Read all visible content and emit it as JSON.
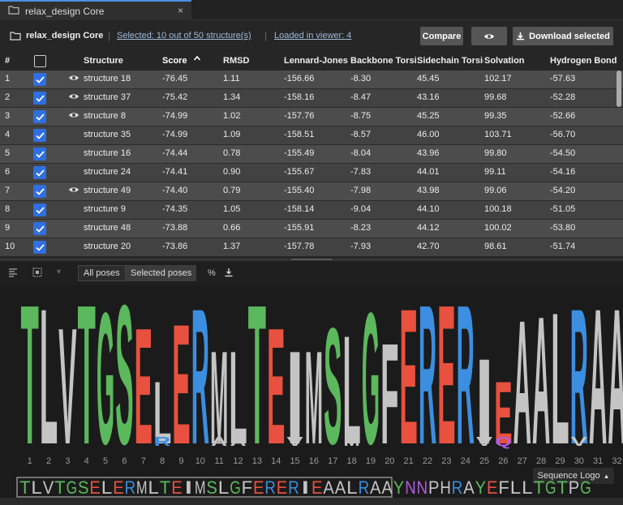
{
  "tab": {
    "title": "relax_design Core",
    "close": "×"
  },
  "toolbar": {
    "project": "relax_design Core",
    "selected": "Selected: 10 out of 50 structure(s)",
    "loaded": "Loaded in viewer: 4",
    "compare": "Compare",
    "download": "Download selected"
  },
  "table": {
    "columns": [
      "#",
      "Structure",
      "Score",
      "RMSD",
      "Lennard-Jones",
      "Backbone Torsic",
      "Sidechain Torsic",
      "Solvation",
      "Hydrogen Bond"
    ],
    "rows": [
      {
        "n": "1",
        "structure": "structure 18",
        "score": "-76.45",
        "rmsd": "1.11",
        "lj": "-156.66",
        "bb": "-8.30",
        "sc": "45.45",
        "solv": "102.17",
        "hb": "-57.63",
        "eye": true
      },
      {
        "n": "2",
        "structure": "structure 37",
        "score": "-75.42",
        "rmsd": "1.34",
        "lj": "-158.16",
        "bb": "-8.47",
        "sc": "43.16",
        "solv": "99.68",
        "hb": "-52.28",
        "eye": true
      },
      {
        "n": "3",
        "structure": "structure 8",
        "score": "-74.99",
        "rmsd": "1.02",
        "lj": "-157.76",
        "bb": "-8.75",
        "sc": "45.25",
        "solv": "99.35",
        "hb": "-52.66",
        "eye": true
      },
      {
        "n": "4",
        "structure": "structure 35",
        "score": "-74.99",
        "rmsd": "1.09",
        "lj": "-158.51",
        "bb": "-8.57",
        "sc": "46.00",
        "solv": "103.71",
        "hb": "-56.70",
        "eye": false
      },
      {
        "n": "5",
        "structure": "structure 16",
        "score": "-74.44",
        "rmsd": "0.78",
        "lj": "-155.49",
        "bb": "-8.04",
        "sc": "43.96",
        "solv": "99.80",
        "hb": "-54.50",
        "eye": false
      },
      {
        "n": "6",
        "structure": "structure 24",
        "score": "-74.41",
        "rmsd": "0.90",
        "lj": "-155.67",
        "bb": "-7.83",
        "sc": "44.01",
        "solv": "99.11",
        "hb": "-54.16",
        "eye": false
      },
      {
        "n": "7",
        "structure": "structure 49",
        "score": "-74.40",
        "rmsd": "0.79",
        "lj": "-155.40",
        "bb": "-7.98",
        "sc": "43.98",
        "solv": "99.06",
        "hb": "-54.20",
        "eye": true
      },
      {
        "n": "8",
        "structure": "structure 9",
        "score": "-74.35",
        "rmsd": "1.05",
        "lj": "-158.14",
        "bb": "-9.04",
        "sc": "44.10",
        "solv": "100.18",
        "hb": "-51.05",
        "eye": false
      },
      {
        "n": "9",
        "structure": "structure 48",
        "score": "-73.88",
        "rmsd": "0.66",
        "lj": "-155.91",
        "bb": "-8.23",
        "sc": "44.12",
        "solv": "100.02",
        "hb": "-53.80",
        "eye": false
      },
      {
        "n": "10",
        "structure": "structure 20",
        "score": "-73.86",
        "rmsd": "1.37",
        "lj": "-157.78",
        "bb": "-7.93",
        "sc": "42.70",
        "solv": "98.61",
        "hb": "-51.74",
        "eye": false
      }
    ]
  },
  "logo_toolbar": {
    "all_poses": "All poses",
    "selected_poses": "Selected poses",
    "percent": "%"
  },
  "logo": {
    "letters": [
      "T",
      "L",
      "V",
      "T",
      "G",
      "S",
      "E",
      "L",
      "E",
      "R",
      "M",
      "L",
      "T",
      "E",
      "I",
      "M",
      "S",
      "L",
      "G",
      "F",
      "E",
      "R",
      "E",
      "R",
      "I",
      "E",
      "A",
      "A",
      "L",
      "R",
      "A",
      "A"
    ],
    "secondary": [
      "",
      "",
      "",
      "",
      "",
      "",
      "",
      "R",
      "",
      "",
      "A",
      "A",
      "",
      "",
      "V",
      "",
      "",
      "M",
      "",
      "",
      "",
      "",
      "",
      "",
      "V",
      "Q",
      "",
      "",
      "",
      "V",
      "",
      ""
    ],
    "positions": [
      "1",
      "2",
      "3",
      "4",
      "5",
      "6",
      "7",
      "8",
      "9",
      "10",
      "11",
      "12",
      "13",
      "14",
      "15",
      "16",
      "17",
      "18",
      "19",
      "20",
      "21",
      "22",
      "23",
      "24",
      "25",
      "26",
      "27",
      "28",
      "29",
      "30",
      "31",
      "32"
    ]
  },
  "sequence_logo_label": "Sequence Logo",
  "minimap_sequence": "TLVTGSELERMLTEIMSLGFERERIEAALRAAYNNPHRAYEFLLTGTPG",
  "colors": {
    "G": "#5cb85c",
    "hydrophobic": "#c8c8c8",
    "acidic": "#e8513f",
    "basic": "#3b8ee0",
    "polar": "#5cb85c"
  }
}
